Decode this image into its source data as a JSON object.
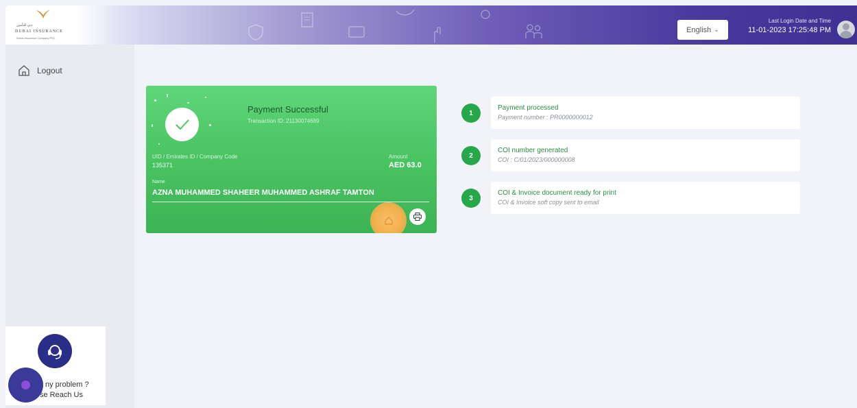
{
  "header": {
    "brand": {
      "name": "DUBAI INSURANCE",
      "tagline": "Dubai Insurance Company PSC",
      "arabic": "دبي للتأمين"
    },
    "language": {
      "selected": "English"
    },
    "last_login": {
      "label": "Last Login Date and Time",
      "value": "11-01-2023 17:25:48 PM"
    }
  },
  "sidebar": {
    "items": [
      {
        "label": "Logout",
        "icon": "home-icon"
      }
    ]
  },
  "help": {
    "line1": "ny problem ?",
    "line2": "se Reach Us"
  },
  "payment": {
    "title": "Payment Successful",
    "transaction": "Transaction ID: 21130074689",
    "uid_label": "UID / Emirates ID / Company Code",
    "uid_value": "135371",
    "amount_label": "Amount",
    "amount_value": "AED 63.0",
    "name_label": "Name",
    "name_value": "AZNA MUHAMMED SHAHEER MUHAMMED ASHRAF TAMTON"
  },
  "steps": [
    {
      "num": "1",
      "title": "Payment processed",
      "sub": "Payment number : PR0000000012"
    },
    {
      "num": "2",
      "title": "COI number generated",
      "sub": "COI : C/01/2023/000000008"
    },
    {
      "num": "3",
      "title": "COI & Invoice document ready for print",
      "sub": "COI & Invoice soft copy sent to email"
    }
  ],
  "colors": {
    "success_green": "#4cc565",
    "step_green": "#26a84a",
    "header_purple": "#4a3a9e",
    "highlight": "#f2b04d"
  }
}
